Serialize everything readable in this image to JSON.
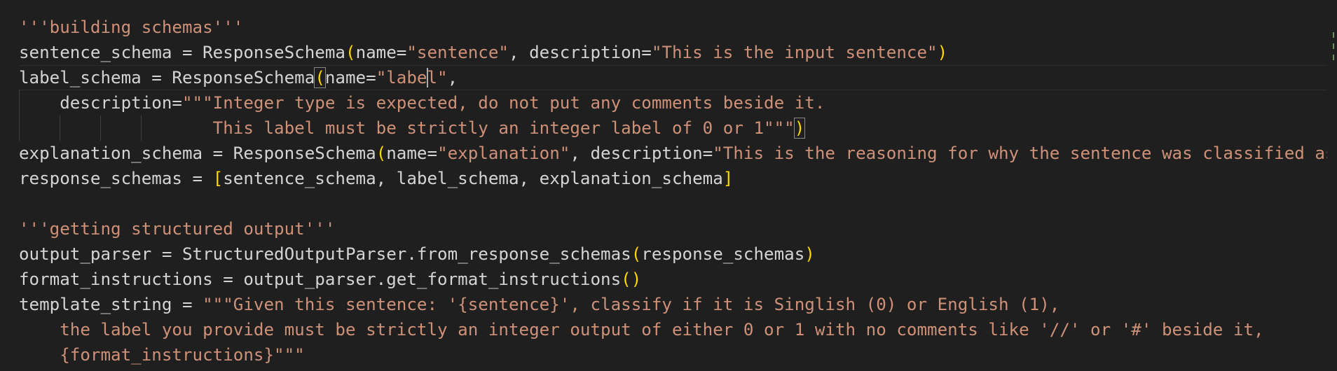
{
  "lines": [
    [
      {
        "t": "str",
        "v": "'''building schemas'''"
      }
    ],
    [
      {
        "t": "plain",
        "v": "sentence_schema = ResponseSchema"
      },
      {
        "t": "bracket",
        "v": "("
      },
      {
        "t": "plain",
        "v": "name="
      },
      {
        "t": "str",
        "v": "\"sentence\""
      },
      {
        "t": "plain",
        "v": ", description="
      },
      {
        "t": "str",
        "v": "\"This is the input sentence\""
      },
      {
        "t": "bracket",
        "v": ")"
      }
    ],
    [
      {
        "t": "plain",
        "v": "label_schema = ResponseSchema"
      },
      {
        "t": "bracket-match",
        "v": "("
      },
      {
        "t": "plain",
        "v": "name="
      },
      {
        "t": "str",
        "v": "\"labe"
      },
      {
        "t": "cursor",
        "v": ""
      },
      {
        "t": "str",
        "v": "l\""
      },
      {
        "t": "plain",
        "v": ","
      }
    ],
    [
      {
        "t": "plain",
        "v": "    description="
      },
      {
        "t": "str",
        "v": "\"\"\"Integer type is expected, do not put any comments beside it."
      }
    ],
    [
      {
        "t": "str",
        "v": "                   This label must be strictly an integer label of 0 or 1\"\"\""
      },
      {
        "t": "bracket-match",
        "v": ")"
      }
    ],
    [
      {
        "t": "plain",
        "v": "explanation_schema = ResponseSchema"
      },
      {
        "t": "bracket",
        "v": "("
      },
      {
        "t": "plain",
        "v": "name="
      },
      {
        "t": "str",
        "v": "\"explanation\""
      },
      {
        "t": "plain",
        "v": ", description="
      },
      {
        "t": "str",
        "v": "\"This is the reasoning for why the sentence was classified as"
      }
    ],
    [
      {
        "t": "plain",
        "v": "response_schemas = "
      },
      {
        "t": "bracket",
        "v": "["
      },
      {
        "t": "plain",
        "v": "sentence_schema, label_schema, explanation_schema"
      },
      {
        "t": "bracket",
        "v": "]"
      }
    ],
    [],
    [
      {
        "t": "str",
        "v": "'''getting structured output'''"
      }
    ],
    [
      {
        "t": "plain",
        "v": "output_parser = StructuredOutputParser.from_response_schemas"
      },
      {
        "t": "bracket",
        "v": "("
      },
      {
        "t": "plain",
        "v": "response_schemas"
      },
      {
        "t": "bracket",
        "v": ")"
      }
    ],
    [
      {
        "t": "plain",
        "v": "format_instructions = output_parser.get_format_instructions"
      },
      {
        "t": "bracket",
        "v": "()"
      }
    ],
    [
      {
        "t": "plain",
        "v": "template_string = "
      },
      {
        "t": "str",
        "v": "\"\"\"Given this sentence: '{sentence}', classify if it is Singlish (0) or English (1),"
      }
    ],
    [
      {
        "t": "str",
        "v": "    the label you provide must be strictly an integer output of either 0 or 1 with no comments like '//' or '#' beside it,"
      }
    ],
    [
      {
        "t": "str",
        "v": "    {format_instructions}\"\"\""
      }
    ]
  ],
  "colors": {
    "background": "#1f1f1f",
    "string": "#ce9178",
    "plain": "#d4d4d4",
    "bracket": "#ffd700"
  }
}
